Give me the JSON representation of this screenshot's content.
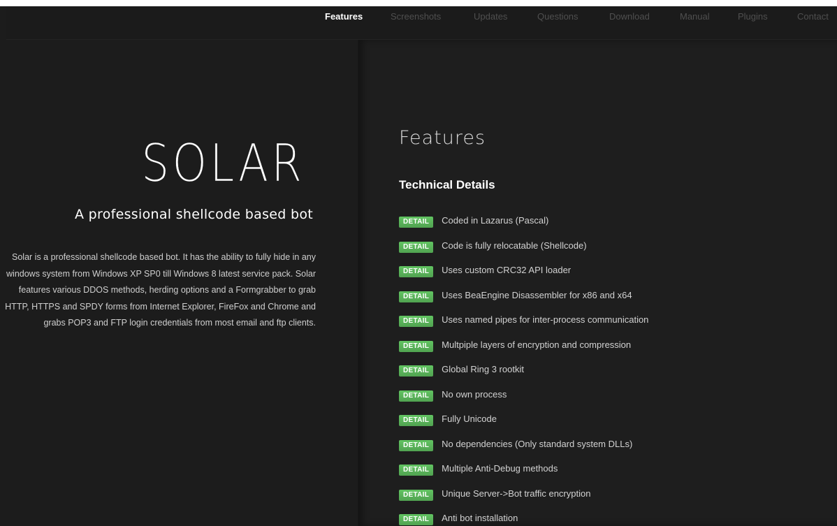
{
  "nav": {
    "items": [
      {
        "label": "Features",
        "active": true
      },
      {
        "label": "Screenshots",
        "active": false
      },
      {
        "label": "Updates",
        "active": false
      },
      {
        "label": "Questions",
        "active": false
      },
      {
        "label": "Download",
        "active": false
      },
      {
        "label": "Manual",
        "active": false
      },
      {
        "label": "Plugins",
        "active": false
      },
      {
        "label": "Contact",
        "active": false
      }
    ]
  },
  "hero": {
    "logo": "SOLAR",
    "tagline": "A professional shellcode based bot",
    "description": "Solar is a professional shellcode based bot. It has the ability to fully hide in any windows system from Windows XP SP0 till Windows 8 latest service pack. Solar features various DDOS methods, herding options and a Formgrabber to grab HTTP, HTTPS and SPDY forms from Internet Explorer, FireFox and Chrome and grabs POP3 and FTP login credentials from most email and ftp clients."
  },
  "features": {
    "title": "Features",
    "section_title": "Technical Details",
    "badge_label": "DETAIL",
    "items": [
      "Coded in Lazarus (Pascal)",
      "Code is fully relocatable (Shellcode)",
      "Uses custom CRC32 API loader",
      "Uses BeaEngine Disassembler for x86 and x64",
      "Uses named pipes for inter-process communication",
      "Multpiple layers of encryption and compression",
      "Global Ring 3 rootkit",
      "No own process",
      "Fully Unicode",
      "No dependencies (Only standard system DLLs)",
      "Multiple Anti-Debug methods",
      "Unique Server->Bot traffic encryption",
      "Anti bot installation"
    ]
  },
  "colors": {
    "background": "#1c1c1c",
    "badge": "#5cb85c",
    "nav_inactive": "#4f4f4f",
    "nav_active": "#ffffff"
  }
}
